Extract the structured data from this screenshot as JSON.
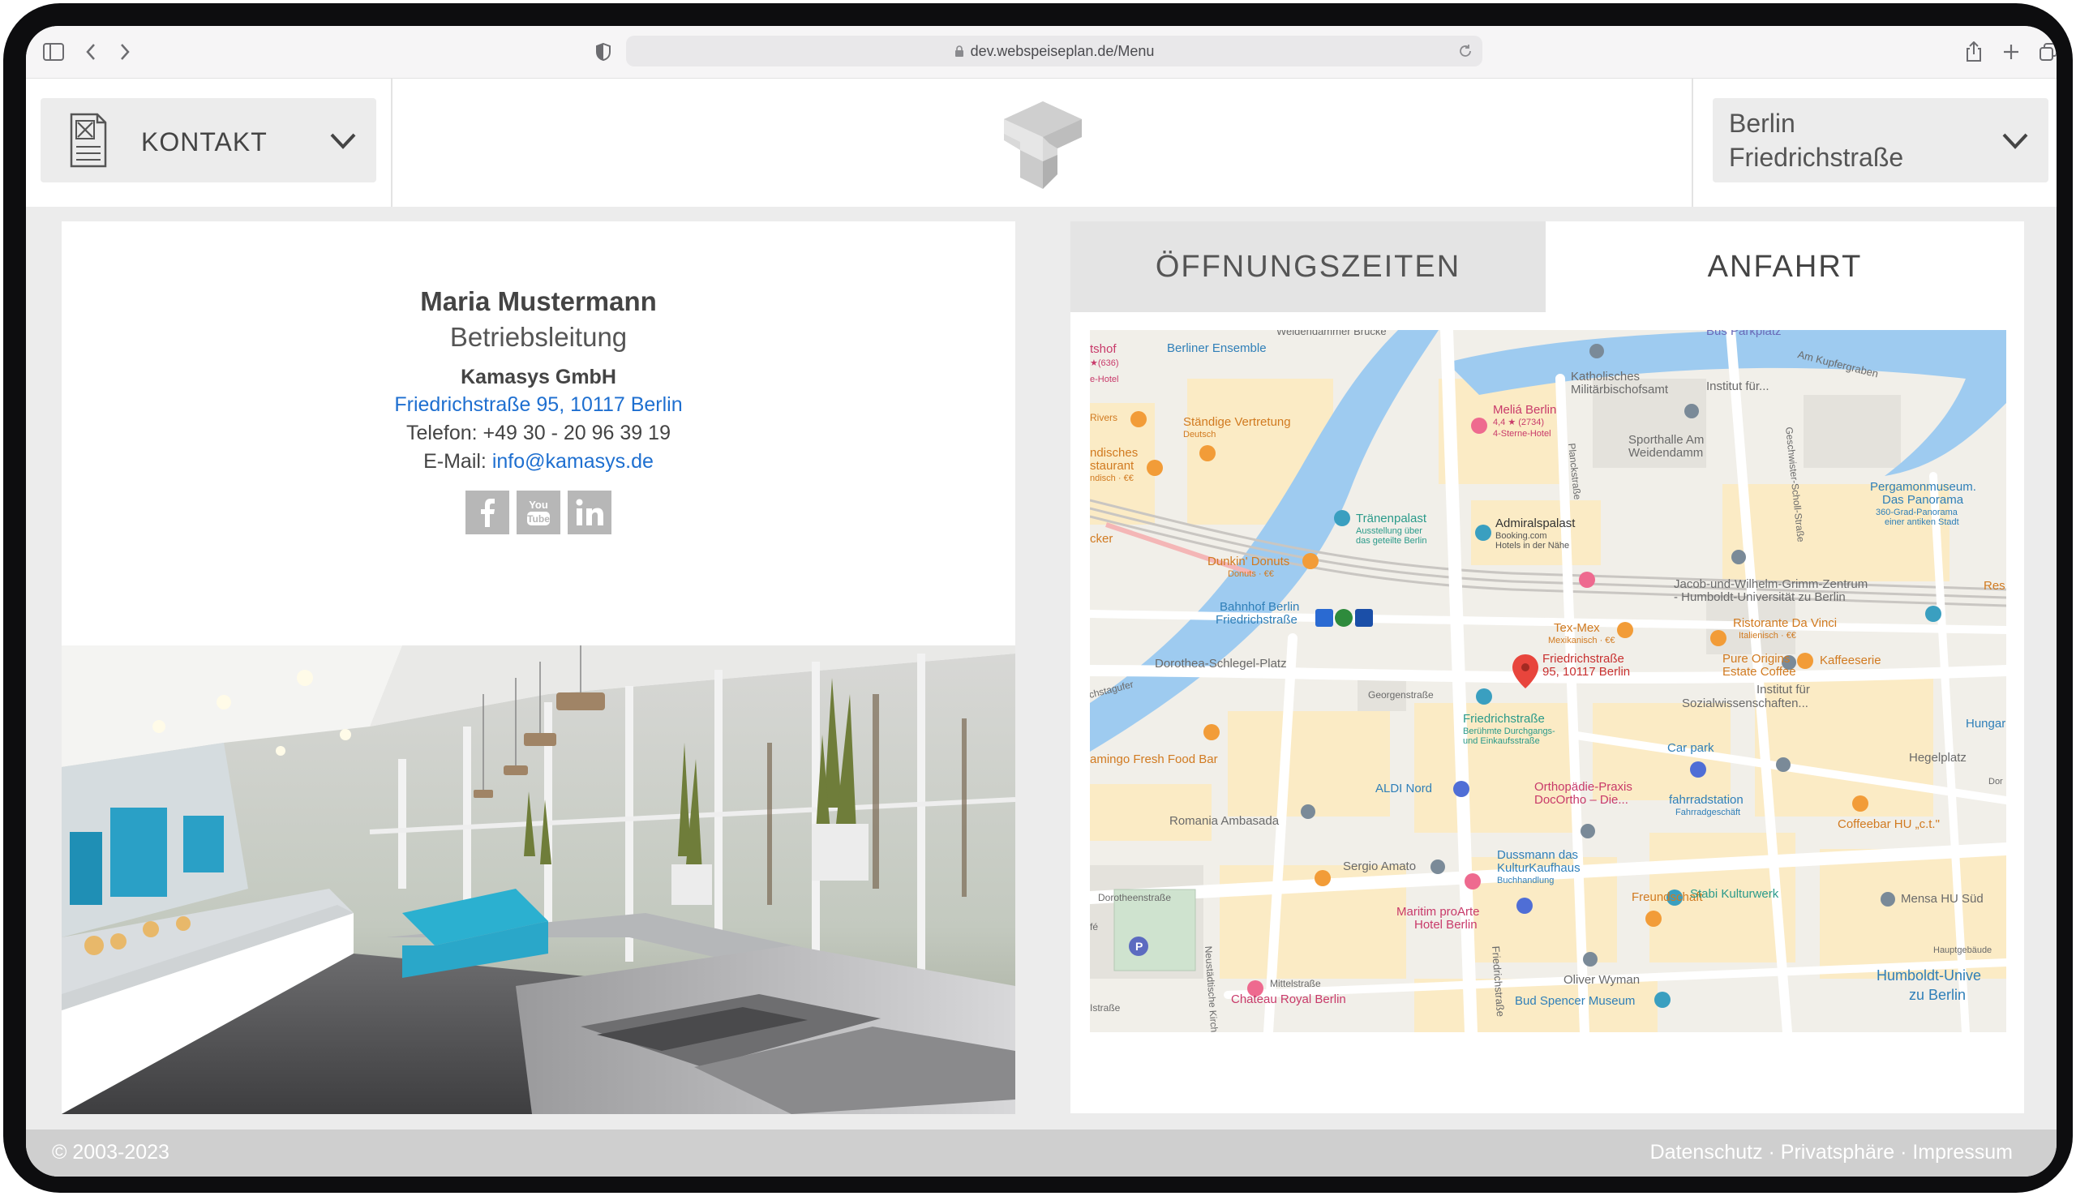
{
  "browser": {
    "url": "dev.webspeiseplan.de/Menu"
  },
  "header": {
    "contact_label": "KONTAKT",
    "location_line1": "Berlin",
    "location_line2": "Friedrichstraße"
  },
  "contact": {
    "name": "Maria Mustermann",
    "role": "Betriebsleitung",
    "company": "Kamasys GmbH",
    "address": "Friedrichstraße 95, 10117 Berlin",
    "phone": "Telefon: +49 30 - 20 96 39 19",
    "email_label": "E-Mail: ",
    "email": "info@kamasys.de",
    "socials": [
      "facebook-icon",
      "youtube-icon",
      "linkedin-icon"
    ]
  },
  "tabs": {
    "opening_hours": "ÖFFNUNGSZEITEN",
    "directions": "ANFAHRT"
  },
  "map": {
    "pin_label_1": "Friedrichstraße",
    "pin_label_2": "95, 10117 Berlin",
    "labels": {
      "berliner_ensemble": "Berliner Ensemble",
      "staendige": "Ständige Vertretung",
      "deutsch": "Deutsch",
      "melia": "Meliá Berlin",
      "melia_rating": "4,4 ★ (2734)",
      "melia_sub": "4-Sterne-Hotel",
      "katholisches": "Katholisches",
      "militaer": "Militärbischofsamt",
      "institut_fuer": "Institut für...",
      "sporthalle": "Sporthalle Am",
      "weidendamm": "Weidendamm",
      "am_kupfergraben": "Am Kupfergraben",
      "pergamon": "Pergamonmuseum.",
      "panorama": "Das Panorama",
      "panorama_sub1": "360-Grad-Panorama",
      "panorama_sub2": "einer antiken Stadt",
      "traenenpalast": "Tränenpalast",
      "traenen_sub1": "Ausstellung über",
      "traenen_sub2": "das geteilte Berlin",
      "admiralspalast": "Admiralspalast",
      "admiral_sub1": "Booking.com",
      "admiral_sub2": "Hotels in der Nähe",
      "dunkin": "Dunkin' Donuts",
      "dunkin_sub": "Donuts · €€",
      "bahnhof": "Bahnhof Berlin",
      "bahnhof2": "Friedrichstraße",
      "grimm": "Jacob-und-Wilhelm-Grimm-Zentrum",
      "grimm2": "- Humboldt-Universität zu Berlin",
      "texmex": "Tex-Mex",
      "texmex_sub": "Mexikanisch · €€",
      "ristorante": "Ristorante Da Vinci",
      "ristorante_sub": "Italienisch · €€",
      "dorothea": "Dorothea-Schlegel-Platz",
      "georgen": "Georgenstraße",
      "friedrichstr_station": "Friedrichstraße",
      "friedrichstr_sub1": "Berühmte Durchgangs-",
      "friedrichstr_sub2": "und Einkaufsstraße",
      "pure_origins": "Pure Origins",
      "estate_coffee": "Estate Coffee",
      "kaffeeserie": "Kaffeeserie",
      "institut_sozial1": "Institut für",
      "institut_sozial2": "Sozialwissenschaften...",
      "flamingo": "amingo Fresh Food Bar",
      "aldi": "ALDI Nord",
      "orthopaedie1": "Orthopädie-Praxis",
      "orthopaedie2": "DocOrtho – Die...",
      "carpark": "Car park",
      "fahrrad": "fahrradstation",
      "fahrrad_sub": "Fahrradgeschäft",
      "hegelplatz": "Hegelplatz",
      "romania": "Romania Ambasada",
      "dussmann1": "Dussmann das",
      "dussmann2": "KulturKaufhaus",
      "dussmann_sub": "Buchhandlung",
      "coffeebar": "Coffeebar HU „c.t.\"",
      "sergio": "Sergio Amato",
      "maritim1": "Maritim proArte",
      "maritim2": "Hotel Berlin",
      "freundschaft": "Freundschaft",
      "stabi": "Stabi Kulturwerk",
      "mensa": "Mensa HU Süd",
      "dorotheen": "Dorotheenstraße",
      "mittel": "Mittelstraße",
      "oliver": "Oliver Wyman",
      "hauptgebaeude": "Hauptgebäude",
      "humboldt1": "Humboldt-Unive",
      "humboldt2": "zu Berlin",
      "chateau": "Chateau Royal Berlin",
      "bud": "Bud Spencer Museum",
      "planckstr": "Planckstraße",
      "friedrichstr_road": "Friedrichstraße",
      "neustaedt": "Neustädtische Kirch",
      "geschwister": "Geschwister-Scholl-Straße",
      "bus_parkplatz": "Bus Parkplatz",
      "weidendammer": "Weidendammer Brücke",
      "hungar": "Hungar",
      "res": "Res",
      "dor": "Dor",
      "rivers": "Rivers",
      "tshof": "tshof",
      "tshof_rating": "★(636)",
      "hotel": "e-Hotel",
      "ndisches": "ndisches",
      "staurant": "staurant",
      "ndisch": "ndisch · €€",
      "cker": "cker",
      "stagufer": "chstagufer",
      "strasse": "Istraße",
      "fe": "fé"
    }
  },
  "footer": {
    "copyright": "© 2003-2023",
    "links": "Datenschutz · Privatsphäre · Impressum"
  },
  "colors": {
    "link": "#1e6fd0",
    "water": "#9ecbf0",
    "road": "#ffffff",
    "block": "#fbe9c2",
    "pin": "#e8453c"
  }
}
